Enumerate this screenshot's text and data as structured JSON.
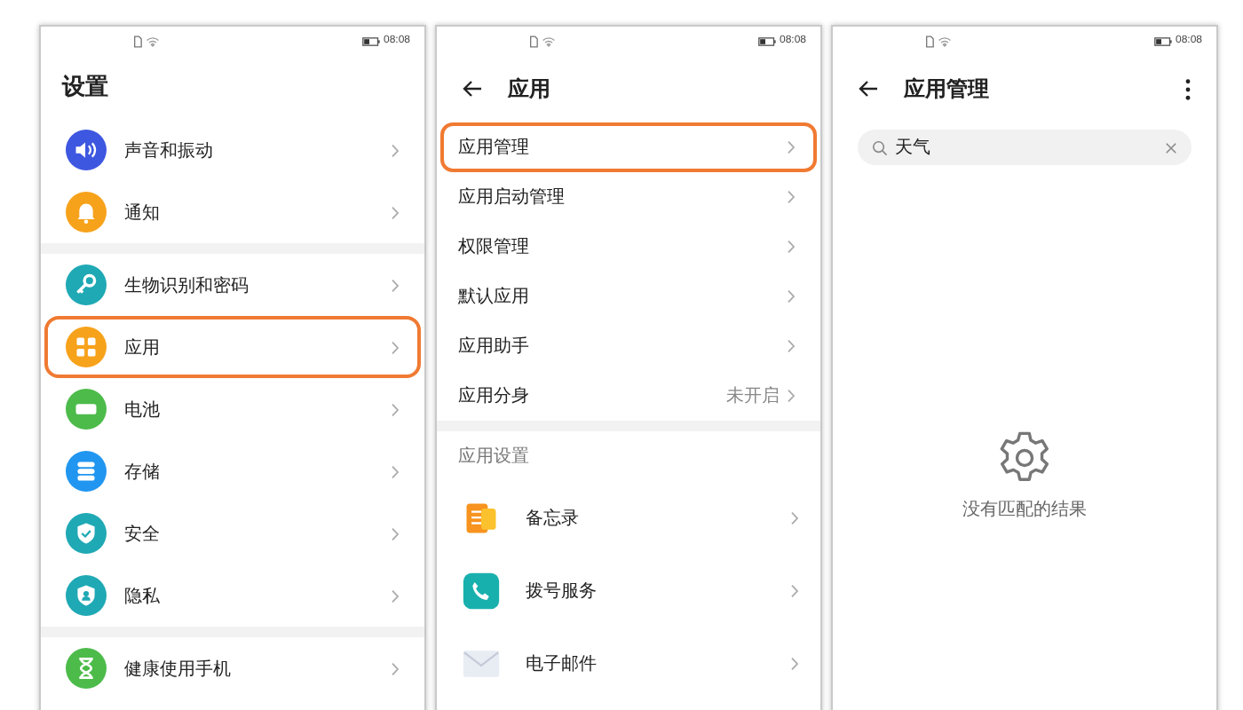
{
  "settings_screen": {
    "status_time": "08:08",
    "title": "设置",
    "groups": [
      [
        {
          "label": "声音和振动",
          "kind": "sound",
          "color": "#3d57e0",
          "highlighted": false
        },
        {
          "label": "通知",
          "kind": "bell",
          "color": "#f7a21b",
          "highlighted": false
        }
      ],
      [
        {
          "label": "生物识别和密码",
          "kind": "key",
          "color": "#1fa9b4",
          "highlighted": false
        },
        {
          "label": "应用",
          "kind": "grid",
          "color": "#f7a21b",
          "highlighted": true
        },
        {
          "label": "电池",
          "kind": "battery",
          "color": "#4cbb4a",
          "highlighted": false
        },
        {
          "label": "存储",
          "kind": "storage",
          "color": "#2196f0",
          "highlighted": false
        },
        {
          "label": "安全",
          "kind": "shield",
          "color": "#1fa9b4",
          "highlighted": false
        },
        {
          "label": "隐私",
          "kind": "privacy",
          "color": "#1fa9b4",
          "highlighted": false
        }
      ],
      [
        {
          "label": "健康使用手机",
          "kind": "hourglass",
          "color": "#4cbb4a",
          "highlighted": false
        }
      ]
    ]
  },
  "apps_screen": {
    "status_time": "08:08",
    "title": "应用",
    "items": [
      {
        "label": "应用管理",
        "highlighted": true
      },
      {
        "label": "应用启动管理",
        "highlighted": false
      },
      {
        "label": "权限管理",
        "highlighted": false
      },
      {
        "label": "默认应用",
        "highlighted": false
      },
      {
        "label": "应用助手",
        "highlighted": false
      },
      {
        "label": "应用分身",
        "value": "未开启",
        "highlighted": false
      }
    ],
    "section_title": "应用设置",
    "apps": [
      {
        "label": "备忘录",
        "kind": "memo",
        "color": "#f7931e"
      },
      {
        "label": "拨号服务",
        "kind": "phone",
        "color": "#18b0ad"
      },
      {
        "label": "电子邮件",
        "kind": "mail",
        "color": "#e8ecf3"
      }
    ]
  },
  "app_manager_screen": {
    "status_time": "08:08",
    "title": "应用管理",
    "search": {
      "value": "天气"
    },
    "empty_message": "没有匹配的结果"
  }
}
